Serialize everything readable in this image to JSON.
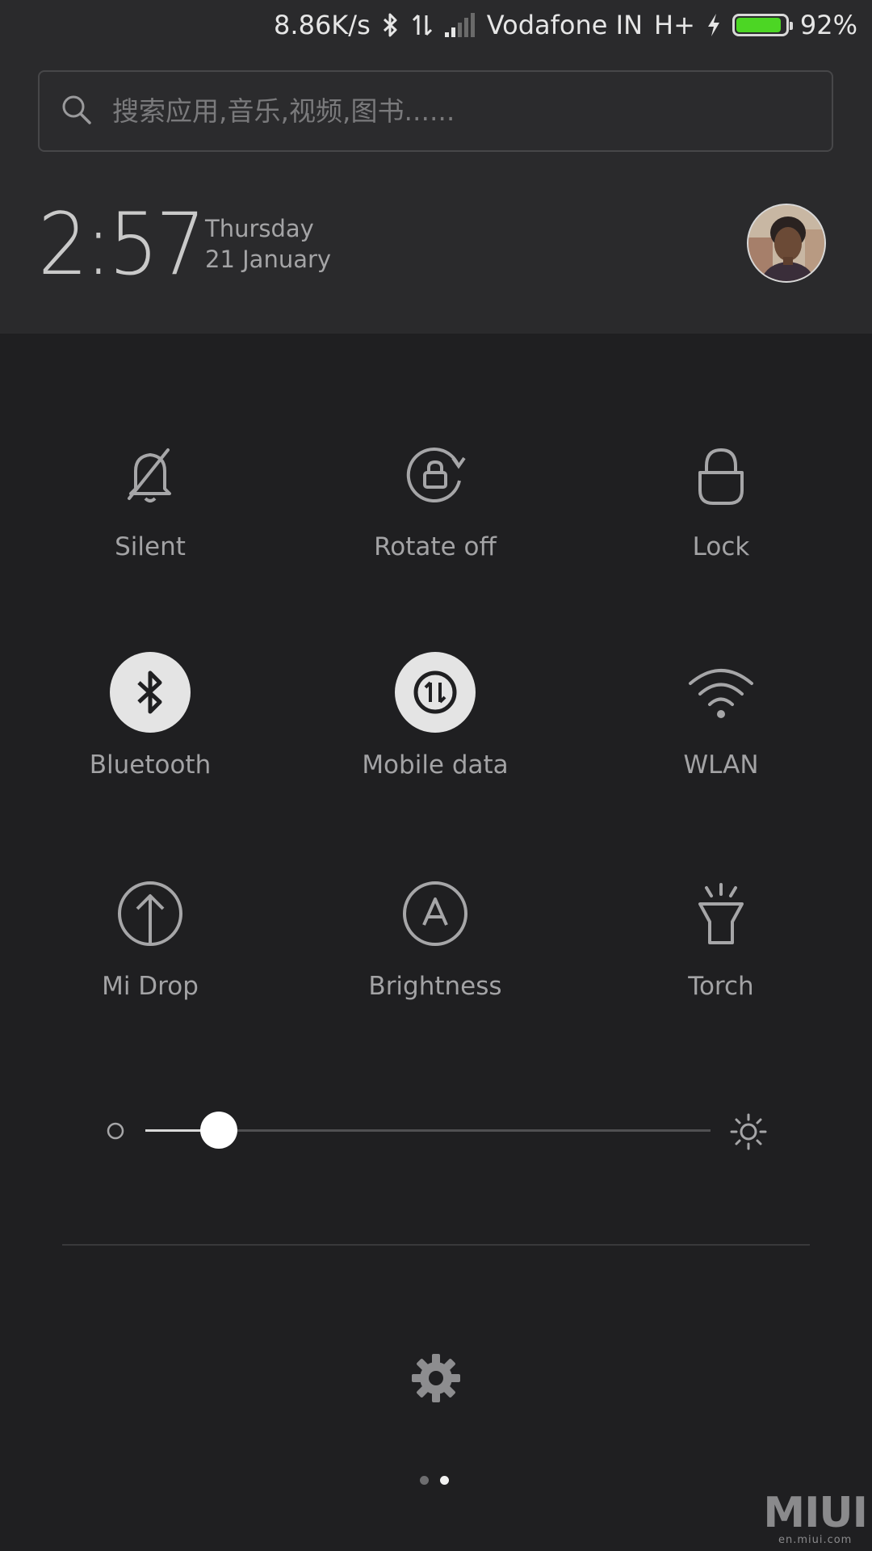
{
  "status_bar": {
    "speed": "8.86K/s",
    "carrier": "Vodafone IN",
    "network": "H+",
    "battery_percent_text": "92%",
    "battery_level": 0.92,
    "battery_color": "#4cd624",
    "icons": [
      "bluetooth-icon",
      "data-transfer-icon",
      "signal-icon",
      "charging-icon",
      "battery-icon"
    ]
  },
  "search": {
    "placeholder": "搜索应用,音乐,视频,图书......"
  },
  "clock": {
    "time": "2:57",
    "day": "Thursday",
    "date": "21 January"
  },
  "toggles": [
    {
      "label": "Silent",
      "icon": "bell-off-icon",
      "active": false
    },
    {
      "label": "Rotate off",
      "icon": "rotate-lock-icon",
      "active": false
    },
    {
      "label": "Lock",
      "icon": "lock-icon",
      "active": false
    },
    {
      "label": "Bluetooth",
      "icon": "bluetooth-icon",
      "active": true
    },
    {
      "label": "Mobile data",
      "icon": "mobile-data-icon",
      "active": true
    },
    {
      "label": "WLAN",
      "icon": "wifi-icon",
      "active": false
    },
    {
      "label": "Mi Drop",
      "icon": "upload-icon",
      "active": false
    },
    {
      "label": "Brightness",
      "icon": "auto-brightness-icon",
      "active": false
    },
    {
      "label": "Torch",
      "icon": "flashlight-icon",
      "active": false
    }
  ],
  "brightness": {
    "level": 0.13
  },
  "pager": {
    "count": 2,
    "active_index": 1
  },
  "watermark": {
    "brand": "MIUI",
    "url": "en.miui.com"
  }
}
